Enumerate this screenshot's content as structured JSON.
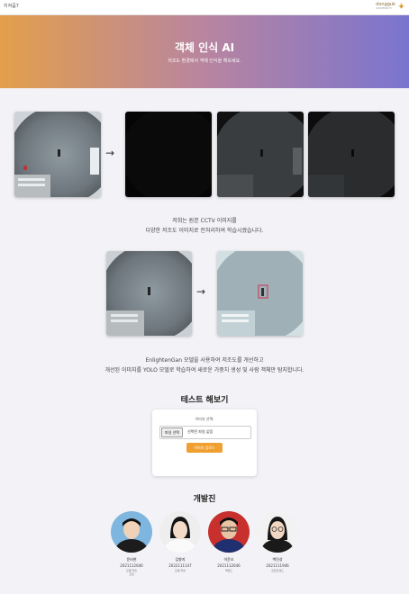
{
  "header": {
    "brand": "지켜줌7",
    "logo_text": "dongguk",
    "logo_sub": "UNIVERSITY"
  },
  "hero": {
    "title": "객체 인식 AI",
    "subtitle": "저조도 환경에서 객체 인식을 해보세요."
  },
  "intro": {
    "line1": "저희는 원본 CCTV 이미지를",
    "line2": "다양한 저조도 이미지로 전처리하여 학습시켰습니다."
  },
  "enlighten": {
    "line1": "EnlightenGan 모델을 사용하여 저조도를 개선하고",
    "line2": "개선된 이미지를 YOLO 모델로 학습하여 새로운 가중치 생성 및 사람 객체만 탐지합니다."
  },
  "test": {
    "title": "테스트 해보기",
    "label": "이미지 선택:",
    "file_button": "파일 선택",
    "file_status": "선택된 파일 없음",
    "submit": "이미지 업로드"
  },
  "team": {
    "title": "개발진",
    "members": [
      {
        "name": "윤비현",
        "id": "2021112646",
        "role": "모델 학습\n코딩"
      },
      {
        "name": "김향지",
        "id": "2022111147",
        "role": "모델 학습"
      },
      {
        "name": "이윤오",
        "id": "2021112646",
        "role": "백엔드"
      },
      {
        "name": "백민성",
        "id": "2021111946",
        "role": "프론트엔드"
      }
    ]
  },
  "colors": {
    "hero_start": "#e39f4b",
    "hero_end": "#7a74cf",
    "accent": "#f0a030"
  }
}
